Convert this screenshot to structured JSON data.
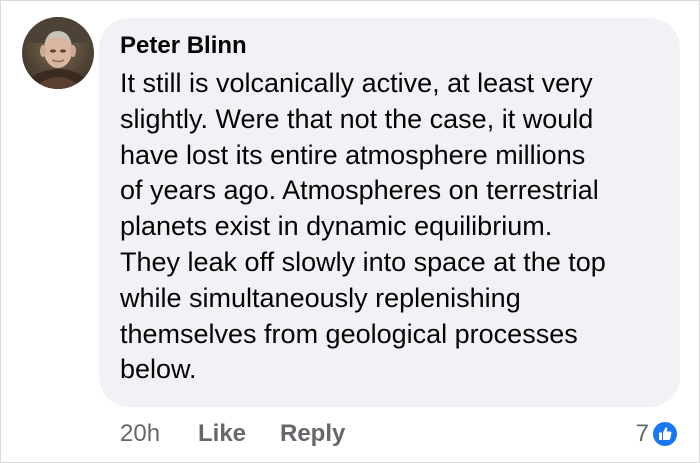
{
  "comment": {
    "author": "Peter Blinn",
    "text_lines": [
      "It still is volcanically active, at least very",
      "slightly. Were that not the case, it would",
      "have lost its entire atmosphere millions",
      "of years ago. Atmospheres on terrestrial",
      "planets exist in dynamic equilibrium.",
      "They leak off slowly into space at the top",
      "while simultaneously replenishing",
      "themselves from geological processes",
      "below."
    ],
    "timestamp": "20h",
    "like_label": "Like",
    "reply_label": "Reply",
    "reaction_count": "7",
    "reaction_icon": "like-icon"
  },
  "colors": {
    "bubble": "#f0f2f5",
    "text": "#050505",
    "secondary_text": "#65676b",
    "like_blue": "#1877f2"
  }
}
